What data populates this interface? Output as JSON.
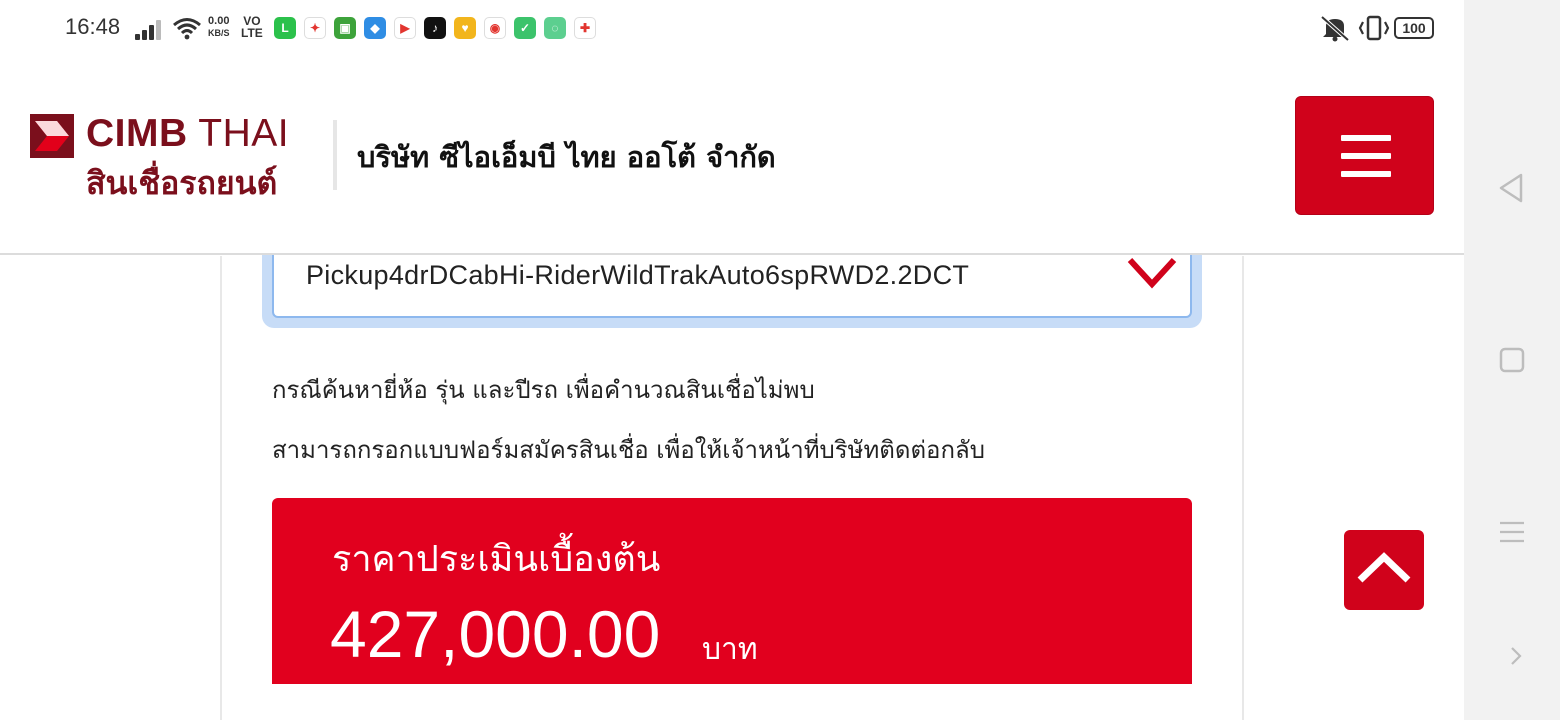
{
  "status_bar": {
    "time": "16:48",
    "net_speed_value": "0.00",
    "net_speed_unit": "KB/S",
    "volte_top": "VO",
    "volte_bottom": "LTE",
    "battery": "100",
    "apps": [
      {
        "icon": "line-app-icon",
        "color": "#2bc14b",
        "glyph": "L"
      },
      {
        "icon": "photos-app-icon",
        "color": "#ffffff",
        "glyph": "✦"
      },
      {
        "icon": "android-app-icon",
        "color": "#3da33b",
        "glyph": "▣"
      },
      {
        "icon": "browser-app-icon",
        "color": "#2f8de4",
        "glyph": "◆"
      },
      {
        "icon": "youtube-app-icon",
        "color": "#ffffff",
        "glyph": "▶"
      },
      {
        "icon": "tiktok-app-icon",
        "color": "#111111",
        "glyph": "♪"
      },
      {
        "icon": "heart-app-icon",
        "color": "#f2b51c",
        "glyph": "♥"
      },
      {
        "icon": "chrome-app-icon",
        "color": "#ffffff",
        "glyph": "◉"
      },
      {
        "icon": "shield-app-icon",
        "color": "#3cc36b",
        "glyph": "✓"
      },
      {
        "icon": "chat-app-icon",
        "color": "#5ccf8f",
        "glyph": "◌"
      },
      {
        "icon": "puzzle-app-icon",
        "color": "#ffffff",
        "glyph": "✚"
      }
    ]
  },
  "header": {
    "logo_brand": "CIMB",
    "logo_country": "THAI",
    "logo_sub": "สินเชื่อรถยนต์",
    "company_name": "บริษัท ซีไอเอ็มบี ไทย ออโต้ จำกัด"
  },
  "form": {
    "selected_model": "Pickup4drDCabHi-RiderWildTrakAuto6spRWD2.2DCT",
    "note_line1": "กรณีค้นหายี่ห้อ รุ่น และปีรถ เพื่อคำนวณสินเชื่อไม่พบ",
    "note_line2": "สามารถกรอกแบบฟอร์มสมัครสินเชื่อ เพื่อให้เจ้าหน้าที่บริษัทติดต่อกลับ"
  },
  "price": {
    "label": "ราคาประเมินเบื้องต้น",
    "value": "427,000.00",
    "unit": "บาท"
  },
  "colors": {
    "brand_red": "#d0021b",
    "price_red": "#e1001e",
    "logo_maroon": "#7b0f1c",
    "select_focus": "#8db8ee"
  }
}
